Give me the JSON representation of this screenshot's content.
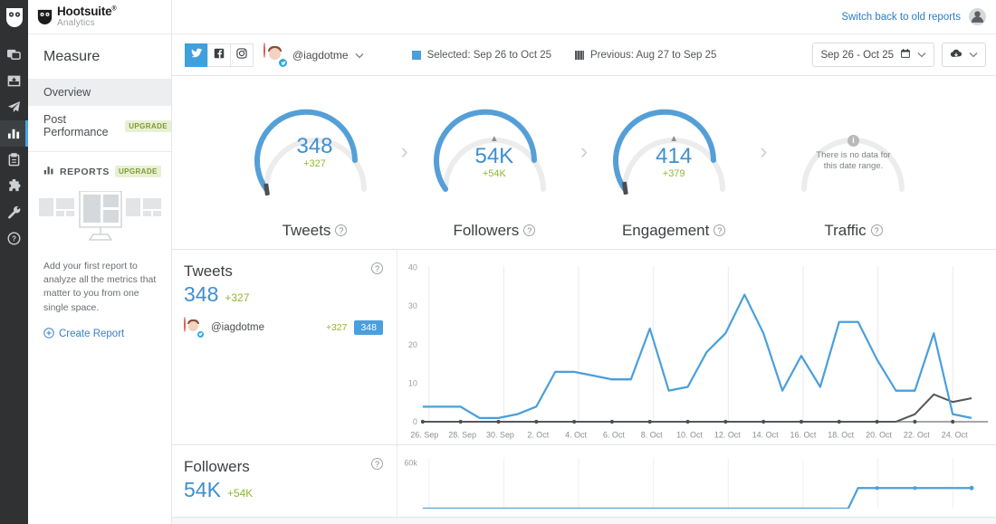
{
  "rail": {
    "logo_icon": "hootsuite-owl-logo",
    "items": [
      {
        "name": "streams",
        "icon": "streams-icon"
      },
      {
        "name": "planner",
        "icon": "inbox-tray-icon"
      },
      {
        "name": "publisher",
        "icon": "paper-plane-icon"
      },
      {
        "name": "analytics",
        "icon": "bar-chart-icon",
        "active": true
      },
      {
        "name": "assignments",
        "icon": "clipboard-icon"
      },
      {
        "name": "apps",
        "icon": "puzzle-piece-icon"
      },
      {
        "name": "tools",
        "icon": "wrench-icon"
      },
      {
        "name": "help",
        "icon": "question-circle-icon"
      }
    ]
  },
  "brand": {
    "title": "Hootsuite",
    "trademark": "®",
    "subtitle": "Analytics"
  },
  "sidebar": {
    "section_title": "Measure",
    "nav": [
      {
        "label": "Overview",
        "badge": "",
        "active": true
      },
      {
        "label": "Post Performance",
        "badge": "UPGRADE",
        "active": false
      }
    ],
    "reports": {
      "heading": "REPORTS",
      "badge": "UPGRADE",
      "illustration_icon": "report-layout-illustration",
      "copy": "Add your first report to analyze all the metrics that matter to you from one single space.",
      "create_label": "Create Report",
      "create_icon": "plus-circle-icon"
    }
  },
  "topbar": {
    "switch_label": "Switch back to old reports",
    "avatar_icon": "user-avatar-icon"
  },
  "toolbar": {
    "networks": [
      {
        "name": "twitter",
        "icon": "twitter-bird-icon",
        "selected": true
      },
      {
        "name": "facebook",
        "icon": "facebook-f-icon",
        "selected": false
      },
      {
        "name": "instagram",
        "icon": "instagram-camera-icon",
        "selected": false
      }
    ],
    "account": {
      "handle": "@iagdotme",
      "avatar_icon": "profile-photo-avatar",
      "network_badge_icon": "twitter-badge-icon",
      "chevron_icon": "chevron-down-icon"
    },
    "legend": [
      {
        "label": "Selected: Sep 26 to Oct 25",
        "swatch": "blue",
        "color": "#4a9fdc"
      },
      {
        "label": "Previous: Aug 27 to Sep 25",
        "swatch": "grey",
        "color": "#55585b"
      }
    ],
    "date_range": {
      "label": "Sep 26 - Oct 25",
      "calendar_icon": "calendar-icon",
      "chevron_icon": "chevron-down-icon"
    },
    "export": {
      "icon": "cloud-download-icon",
      "chevron_icon": "chevron-down-icon"
    }
  },
  "gauges": [
    {
      "label": "Tweets",
      "value": "348",
      "delta": "+327",
      "warning": false,
      "percent": 88,
      "prev_marker": true,
      "no_data": false,
      "help_icon": "question-circle-icon"
    },
    {
      "label": "Followers",
      "value": "54K",
      "delta": "+54K",
      "warning": true,
      "percent": 88,
      "prev_marker": false,
      "no_data": false,
      "help_icon": "question-circle-icon"
    },
    {
      "label": "Engagement",
      "value": "414",
      "delta": "+379",
      "warning": true,
      "percent": 88,
      "prev_marker": true,
      "no_data": false,
      "help_icon": "question-circle-icon"
    },
    {
      "label": "Traffic",
      "value": "",
      "delta": "",
      "warning": false,
      "percent": 0,
      "prev_marker": false,
      "no_data": true,
      "no_data_text": "There is no data for this date range.",
      "info_icon": "info-circle-icon",
      "help_icon": "question-circle-icon"
    }
  ],
  "gauge_separator_icon": "chevron-right-icon",
  "metrics": [
    {
      "name": "Tweets",
      "value": "348",
      "delta": "+327",
      "help_icon": "question-circle-icon",
      "account": {
        "handle": "@iagdotme",
        "delta": "+327",
        "pill": "348",
        "avatar_icon": "profile-photo-avatar"
      }
    },
    {
      "name": "Followers",
      "value": "54K",
      "delta": "+54K",
      "help_icon": "question-circle-icon",
      "account": null
    }
  ],
  "chart_data": [
    {
      "type": "line",
      "title": "Tweets",
      "xlabel": "",
      "ylabel": "",
      "ylim": [
        0,
        40
      ],
      "yticks": [
        0,
        10,
        20,
        30,
        40
      ],
      "grid": true,
      "legend_position": "toolbar",
      "x": [
        "26. Sep",
        "27. Sep",
        "28. Sep",
        "29. Sep",
        "30. Sep",
        "1. Oct",
        "2. Oct",
        "3. Oct",
        "4. Oct",
        "5. Oct",
        "6. Oct",
        "7. Oct",
        "8. Oct",
        "9. Oct",
        "10. Oct",
        "11. Oct",
        "12. Oct",
        "13. Oct",
        "14. Oct",
        "15. Oct",
        "16. Oct",
        "17. Oct",
        "18. Oct",
        "19. Oct",
        "20. Oct",
        "21. Oct",
        "22. Oct",
        "23. Oct",
        "24. Oct",
        "25. Oct"
      ],
      "xticks": [
        "26. Sep",
        "28. Sep",
        "30. Sep",
        "2. Oct",
        "4. Oct",
        "6. Oct",
        "8. Oct",
        "10. Oct",
        "12. Oct",
        "14. Oct",
        "16. Oct",
        "18. Oct",
        "20. Oct",
        "22. Oct",
        "24. Oct"
      ],
      "series": [
        {
          "name": "Selected: Sep 26 to Oct 25",
          "color": "#4a9fdc",
          "values": [
            4,
            4,
            4,
            1,
            1,
            2,
            4,
            13,
            13,
            12,
            11,
            11,
            24,
            8,
            9,
            18,
            23,
            33,
            23,
            8,
            17,
            9,
            26,
            26,
            16,
            8,
            8,
            23,
            2,
            1
          ]
        },
        {
          "name": "Previous: Aug 27 to Sep 25",
          "color": "#55585b",
          "values": [
            0,
            0,
            0,
            0,
            0,
            0,
            0,
            0,
            0,
            0,
            0,
            0,
            0,
            0,
            0,
            0,
            0,
            0,
            0,
            0,
            0,
            0,
            0,
            0,
            0,
            0,
            2,
            7,
            5,
            6
          ]
        }
      ]
    },
    {
      "type": "line",
      "title": "Followers",
      "ylim": [
        0,
        60000
      ],
      "yticks_labels": [
        "60k"
      ],
      "grid": true,
      "series": [
        {
          "name": "Selected: Sep 26 to Oct 25",
          "color": "#4a9fdc",
          "values": [
            0,
            0,
            0,
            0,
            0,
            0,
            0,
            0,
            0,
            0,
            0,
            0,
            0,
            0,
            0,
            0,
            0,
            0,
            0,
            0,
            0,
            0,
            0,
            54000,
            54000,
            54000,
            54000,
            54000,
            54000,
            54000
          ]
        }
      ]
    }
  ]
}
